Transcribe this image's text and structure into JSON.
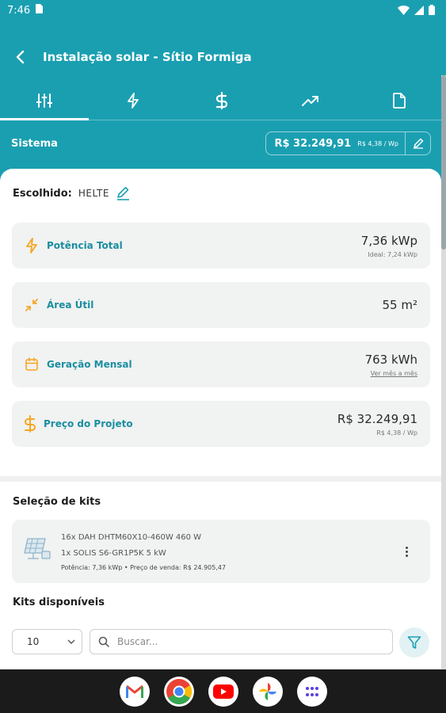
{
  "status_bar": {
    "time": "7:46"
  },
  "app_bar": {
    "title": "Instalação solar - Sítio Formiga"
  },
  "tabs": [
    {
      "icon": "sliders-icon",
      "active": true
    },
    {
      "icon": "lightning-icon",
      "active": false
    },
    {
      "icon": "dollar-icon",
      "active": false
    },
    {
      "icon": "trending-up-icon",
      "active": false
    },
    {
      "icon": "document-icon",
      "active": false
    }
  ],
  "sistema": {
    "label": "Sistema",
    "price": "R$ 32.249,91",
    "price_per_wp": "R$ 4,38 / Wp"
  },
  "chosen": {
    "label": "Escolhido:",
    "value": "HELTE"
  },
  "metrics": [
    {
      "icon": "lightning-icon",
      "label": "Potência Total",
      "value": "7,36 kWp",
      "sub": "Ideal: 7,24 kWp"
    },
    {
      "icon": "compress-icon",
      "label": "Área Útil",
      "value": "55 m²",
      "sub": ""
    },
    {
      "icon": "calendar-icon",
      "label": "Geração Mensal",
      "value": "763 kWh",
      "sub": "Ver mês a mês"
    },
    {
      "icon": "dollar-icon",
      "label": "Preço do Projeto",
      "value": "R$ 32.249,91",
      "sub": "R$ 4,38 / Wp"
    }
  ],
  "kits": {
    "title": "Seleção de kits",
    "selected": {
      "line1": "16x DAH DHTM60X10-460W 460 W",
      "line2": "1x SOLIS S6-GR1P5K 5 kW",
      "line3": "Potência: 7,36 kWp • Preço de venda: R$ 24.905,47"
    },
    "available_title": "Kits disponíveis",
    "page_size": "10",
    "search_placeholder": "Buscar..."
  },
  "colors": {
    "primary": "#1a9fb1",
    "accent_icon": "#f5a623",
    "metric_label": "#1a8ea0"
  }
}
